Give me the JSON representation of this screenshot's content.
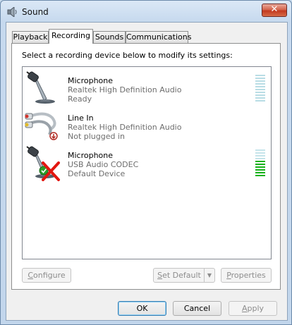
{
  "window": {
    "title": "Sound",
    "close_label": "✕"
  },
  "tabs": [
    {
      "label": "Playback",
      "active": false
    },
    {
      "label": "Recording",
      "active": true
    },
    {
      "label": "Sounds",
      "active": false
    },
    {
      "label": "Communications",
      "active": false
    }
  ],
  "panel": {
    "instruction": "Select a recording device below to modify its settings:"
  },
  "devices": [
    {
      "name": "Microphone",
      "driver": "Realtek High Definition Audio",
      "status": "Ready",
      "icon": "microphone-icon",
      "level": 0
    },
    {
      "name": "Line In",
      "driver": "Realtek High Definition Audio",
      "status": "Not plugged in",
      "icon": "line-in-jack-icon",
      "level": null
    },
    {
      "name": "Microphone",
      "driver": "USB Audio CODEC",
      "status": "Default Device",
      "icon": "microphone-icon",
      "level": 0.6
    }
  ],
  "buttons": {
    "configure_first": "C",
    "configure_rest": "onfigure",
    "set_default_first": "S",
    "set_default_rest": "et Default",
    "properties_first": "P",
    "properties_rest": "roperties",
    "ok": "OK",
    "cancel": "Cancel",
    "apply_first": "A",
    "apply_rest": "pply"
  },
  "colors": {
    "meter_on": "#16b21a",
    "meter_off": "#c5e4ea",
    "meter_idle": "#b9dde5"
  }
}
